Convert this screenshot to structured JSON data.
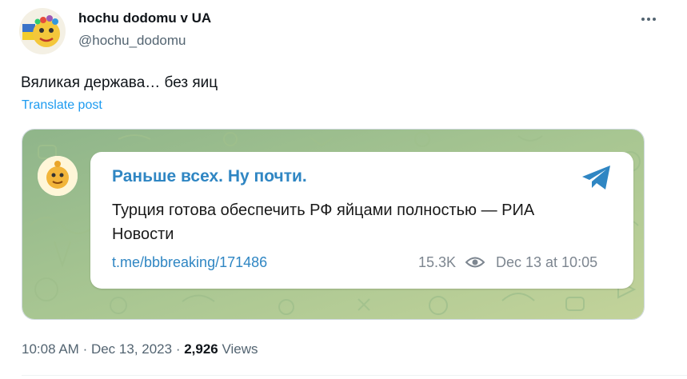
{
  "author": {
    "display_name": "hochu dodomu v UA",
    "handle": "@hochu_dodomu"
  },
  "post": {
    "text": "Вяликая держава… без яиц",
    "translate_label": "Translate post",
    "time": "10:08 AM",
    "date": "Dec 13, 2023",
    "views_count": "2,926",
    "views_label": "Views"
  },
  "embedded_message": {
    "channel_name": "Раньше всех. Ну почти.",
    "text": "Турция готова обеспечить РФ яйцами полностью — РИА Новости",
    "link": "t.me/bbbreaking/171486",
    "views": "15.3K",
    "timestamp": "Dec 13 at 10:05"
  },
  "icons": {
    "more": "more-horizontal-icon",
    "telegram": "telegram-plane-icon",
    "views": "eye-icon"
  },
  "colors": {
    "link": "#1d9bf0",
    "telegram_blue": "#2f86c3",
    "telegram_bg": "#a3c28f",
    "text_secondary": "#536471"
  }
}
